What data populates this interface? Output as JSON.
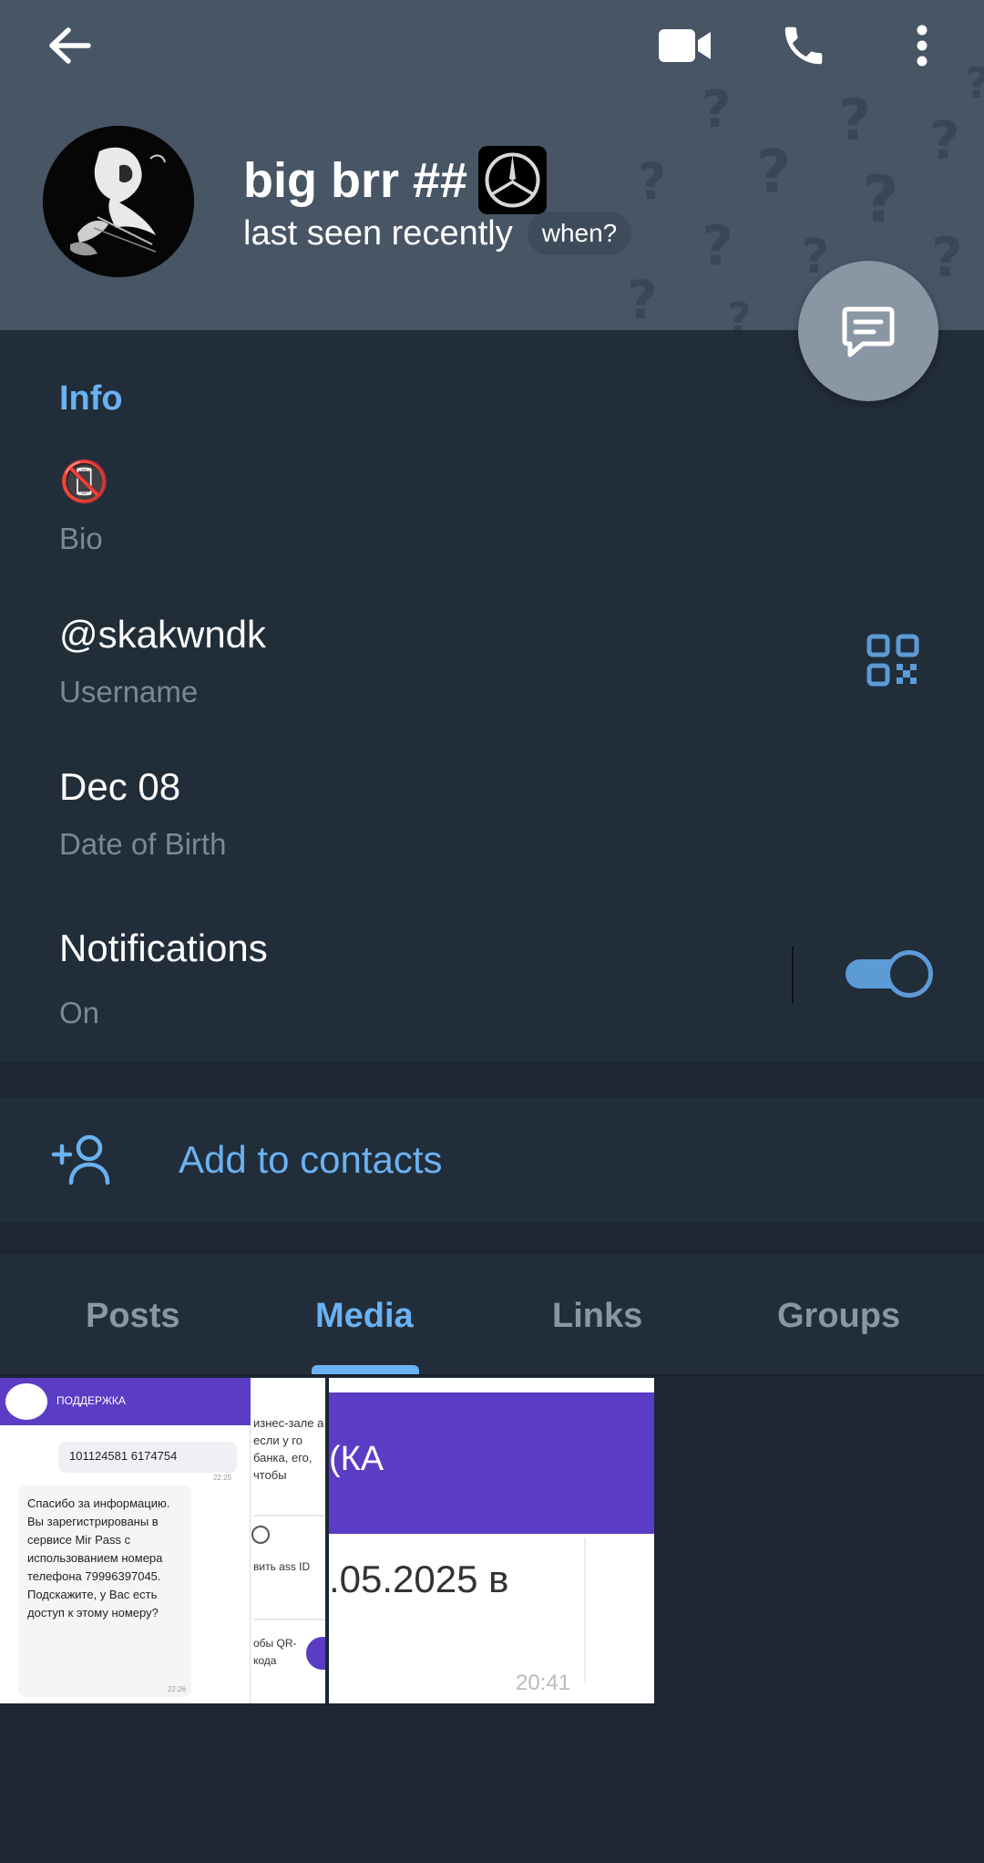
{
  "header": {
    "name": "big brr ##",
    "status": "last seen recently",
    "when_label": "when?",
    "icons": [
      "back-arrow-icon",
      "video-call-icon",
      "phone-icon",
      "more-vertical-icon",
      "message-icon"
    ]
  },
  "info": {
    "section_title": "Info",
    "bio_value": "📵",
    "bio_label": "Bio",
    "username_value": "@skakwndk",
    "username_label": "Username",
    "dob_value": "Dec 08",
    "dob_label": "Date of Birth",
    "notifications_value": "Notifications",
    "notifications_label": "On",
    "notifications_on": true
  },
  "actions": {
    "add_contacts_label": "Add to contacts"
  },
  "tabs": [
    {
      "label": "Posts",
      "active": false
    },
    {
      "label": "Media",
      "active": true
    },
    {
      "label": "Links",
      "active": false
    },
    {
      "label": "Groups",
      "active": false
    }
  ],
  "media": {
    "thumb1": {
      "header": "ПОДДЕРЖКА",
      "number": "101124581 6174754",
      "time1": "22:25",
      "message": "Спасибо за информацию. Вы зарегистрированы в сервисе Mir Pass с использованием номера телефона 79996397045. Подскажите, у Вас есть доступ к этому номеру?",
      "time2": "22:26",
      "side_text": "изнес-зале а если у го банка, его, чтобы",
      "side_text2": "вить ass ID",
      "side_text3": "обы QR-кода"
    },
    "thumb2": {
      "header": "(КА",
      "date": ".05.2025 в",
      "time": "20:41"
    }
  },
  "colors": {
    "accent": "#6ab2f2",
    "header_bg": "#475565",
    "panel_bg": "#222d3a",
    "page_bg": "#1d2733",
    "thumb_purple": "#5b3cc4"
  }
}
